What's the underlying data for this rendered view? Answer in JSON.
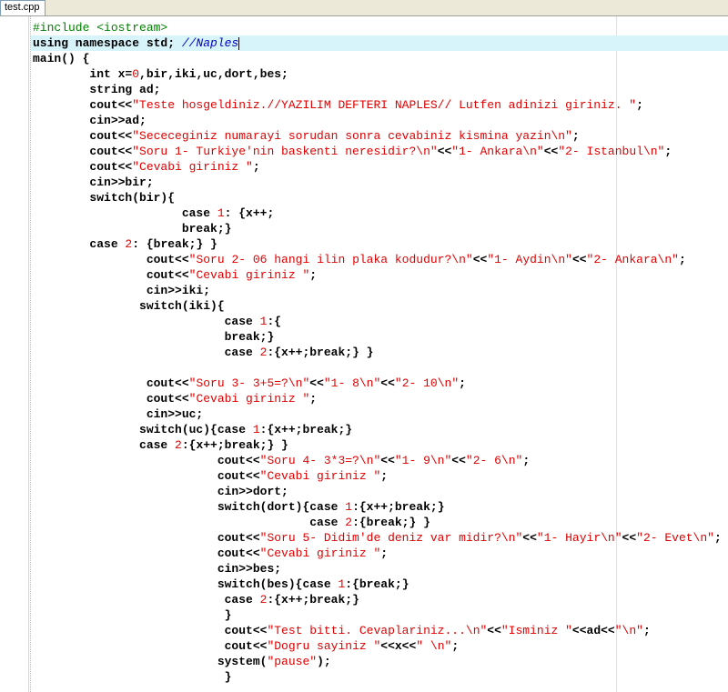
{
  "tab": {
    "label": "test.cpp"
  },
  "code_lines": [
    [
      [
        "pp",
        "#include <iostream>"
      ]
    ],
    [
      [
        "kw",
        "using namespace std; "
      ],
      [
        "cm",
        "//Naples"
      ]
    ],
    [
      [
        "kw",
        "main() {"
      ]
    ],
    [
      [
        "kw",
        "        int x="
      ],
      [
        "num",
        "0"
      ],
      [
        "kw",
        ",bir,iki,uc,dort,bes;"
      ]
    ],
    [
      [
        "kw",
        "        string ad;"
      ]
    ],
    [
      [
        "kw",
        "        cout<<"
      ],
      [
        "str",
        "\"Teste hosgeldiniz.//YAZILIM DEFTERI NAPLES// Lutfen adinizi giriniz. \""
      ],
      [
        "kw",
        ";"
      ]
    ],
    [
      [
        "kw",
        "        cin>>ad;"
      ]
    ],
    [
      [
        "kw",
        "        cout<<"
      ],
      [
        "str",
        "\"Sececeginiz numarayi sorudan sonra cevabiniz kismina yazin\\n\""
      ],
      [
        "kw",
        ";"
      ]
    ],
    [
      [
        "kw",
        "        cout<<"
      ],
      [
        "str",
        "\"Soru 1- Turkiye'nin baskenti neresidir?\\n\""
      ],
      [
        "kw",
        "<<"
      ],
      [
        "str",
        "\"1- Ankara\\n\""
      ],
      [
        "kw",
        "<<"
      ],
      [
        "str",
        "\"2- Istanbul\\n\""
      ],
      [
        "kw",
        ";"
      ]
    ],
    [
      [
        "kw",
        "        cout<<"
      ],
      [
        "str",
        "\"Cevabi giriniz \""
      ],
      [
        "kw",
        ";"
      ]
    ],
    [
      [
        "kw",
        "        cin>>bir;"
      ]
    ],
    [
      [
        "kw",
        "        switch(bir){"
      ]
    ],
    [
      [
        "kw",
        "                     case "
      ],
      [
        "num",
        "1"
      ],
      [
        "kw",
        ": {x++;"
      ]
    ],
    [
      [
        "kw",
        "                     break;}"
      ]
    ],
    [
      [
        "kw",
        "        case "
      ],
      [
        "num",
        "2"
      ],
      [
        "kw",
        ": {break;} }"
      ]
    ],
    [
      [
        "kw",
        "                cout<<"
      ],
      [
        "str",
        "\"Soru 2- 06 hangi ilin plaka kodudur?\\n\""
      ],
      [
        "kw",
        "<<"
      ],
      [
        "str",
        "\"1- Aydin\\n\""
      ],
      [
        "kw",
        "<<"
      ],
      [
        "str",
        "\"2- Ankara\\n\""
      ],
      [
        "kw",
        ";"
      ]
    ],
    [
      [
        "kw",
        "                cout<<"
      ],
      [
        "str",
        "\"Cevabi giriniz \""
      ],
      [
        "kw",
        ";"
      ]
    ],
    [
      [
        "kw",
        "                cin>>iki;"
      ]
    ],
    [
      [
        "kw",
        "               switch(iki){"
      ]
    ],
    [
      [
        "kw",
        "                           case "
      ],
      [
        "num",
        "1"
      ],
      [
        "kw",
        ":{"
      ]
    ],
    [
      [
        "kw",
        "                           break;}"
      ]
    ],
    [
      [
        "kw",
        "                           case "
      ],
      [
        "num",
        "2"
      ],
      [
        "kw",
        ":{x++;break;} }"
      ]
    ],
    [
      [
        "kw",
        ""
      ]
    ],
    [
      [
        "kw",
        "                cout<<"
      ],
      [
        "str",
        "\"Soru 3- 3+5=?\\n\""
      ],
      [
        "kw",
        "<<"
      ],
      [
        "str",
        "\"1- 8\\n\""
      ],
      [
        "kw",
        "<<"
      ],
      [
        "str",
        "\"2- 10\\n\""
      ],
      [
        "kw",
        ";"
      ]
    ],
    [
      [
        "kw",
        "                cout<<"
      ],
      [
        "str",
        "\"Cevabi giriniz \""
      ],
      [
        "kw",
        ";"
      ]
    ],
    [
      [
        "kw",
        "                cin>>uc;"
      ]
    ],
    [
      [
        "kw",
        "               switch(uc){case "
      ],
      [
        "num",
        "1"
      ],
      [
        "kw",
        ":{x++;break;}"
      ]
    ],
    [
      [
        "kw",
        "               case "
      ],
      [
        "num",
        "2"
      ],
      [
        "kw",
        ":{x++;break;} }"
      ]
    ],
    [
      [
        "kw",
        "                          cout<<"
      ],
      [
        "str",
        "\"Soru 4- 3*3=?\\n\""
      ],
      [
        "kw",
        "<<"
      ],
      [
        "str",
        "\"1- 9\\n\""
      ],
      [
        "kw",
        "<<"
      ],
      [
        "str",
        "\"2- 6\\n\""
      ],
      [
        "kw",
        ";"
      ]
    ],
    [
      [
        "kw",
        "                          cout<<"
      ],
      [
        "str",
        "\"Cevabi giriniz \""
      ],
      [
        "kw",
        ";"
      ]
    ],
    [
      [
        "kw",
        "                          cin>>dort;"
      ]
    ],
    [
      [
        "kw",
        "                          switch(dort){case "
      ],
      [
        "num",
        "1"
      ],
      [
        "kw",
        ":{x++;break;}"
      ]
    ],
    [
      [
        "kw",
        "                                       case "
      ],
      [
        "num",
        "2"
      ],
      [
        "kw",
        ":{break;} }"
      ]
    ],
    [
      [
        "kw",
        "                          cout<<"
      ],
      [
        "str",
        "\"Soru 5- Didim'de deniz var midir?\\n\""
      ],
      [
        "kw",
        "<<"
      ],
      [
        "str",
        "\"1- Hayir\\n\""
      ],
      [
        "kw",
        "<<"
      ],
      [
        "str",
        "\"2- Evet\\n\""
      ],
      [
        "kw",
        ";"
      ]
    ],
    [
      [
        "kw",
        "                          cout<<"
      ],
      [
        "str",
        "\"Cevabi giriniz \""
      ],
      [
        "kw",
        ";"
      ]
    ],
    [
      [
        "kw",
        "                          cin>>bes;"
      ]
    ],
    [
      [
        "kw",
        "                          switch(bes){case "
      ],
      [
        "num",
        "1"
      ],
      [
        "kw",
        ":{break;}"
      ]
    ],
    [
      [
        "kw",
        "                           case "
      ],
      [
        "num",
        "2"
      ],
      [
        "kw",
        ":{x++;break;}"
      ]
    ],
    [
      [
        "kw",
        "                           }"
      ]
    ],
    [
      [
        "kw",
        "                           cout<<"
      ],
      [
        "str",
        "\"Test bitti. Cevaplariniz...\\n\""
      ],
      [
        "kw",
        "<<"
      ],
      [
        "str",
        "\"Isminiz \""
      ],
      [
        "kw",
        "<<ad<<"
      ],
      [
        "str",
        "\"\\n\""
      ],
      [
        "kw",
        ";"
      ]
    ],
    [
      [
        "kw",
        "                           cout<<"
      ],
      [
        "str",
        "\"Dogru sayiniz \""
      ],
      [
        "kw",
        "<<x<<"
      ],
      [
        "str",
        "\" \\n\""
      ],
      [
        "kw",
        ";"
      ]
    ],
    [
      [
        "kw",
        "                          system("
      ],
      [
        "str",
        "\"pause\""
      ],
      [
        "kw",
        ");"
      ]
    ],
    [
      [
        "kw",
        "                           }"
      ]
    ]
  ],
  "current_line_index": 1,
  "colors": {
    "preprocessor": "#008000",
    "comment": "#0000c0",
    "string": "#e00000",
    "number": "#e00000",
    "current_line_bg": "#d8f4fb"
  }
}
